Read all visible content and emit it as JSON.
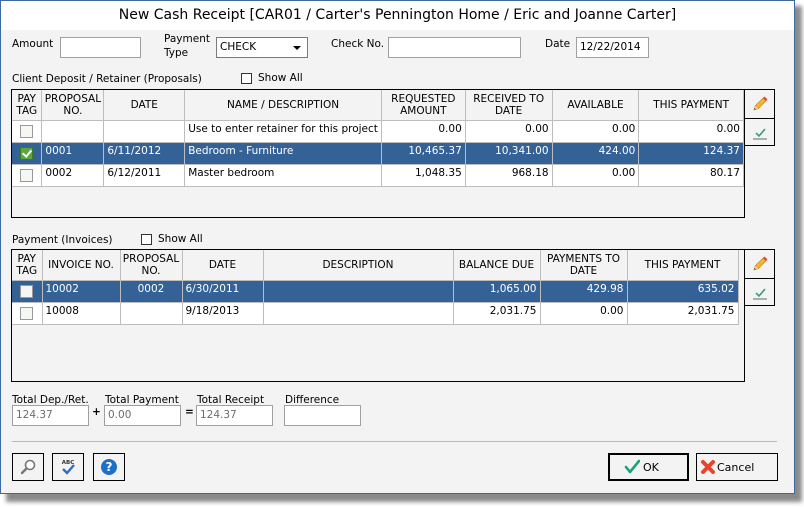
{
  "window": {
    "title": "New Cash Receipt [CAR01 / Carter's Pennington Home / Eric and Joanne Carter]"
  },
  "header": {
    "amount_label": "Amount",
    "amount_value": "",
    "payment_type_label_1": "Payment",
    "payment_type_label_2": "Type",
    "payment_type_value": "CHECK",
    "check_no_label": "Check No.",
    "check_no_value": "",
    "date_label": "Date",
    "date_value": "12/22/2014"
  },
  "deposits": {
    "section_label": "Client Deposit / Retainer (Proposals)",
    "show_all_label": "Show All",
    "show_all_checked": false,
    "columns": [
      {
        "line1": "PAY",
        "line2": "TAG"
      },
      {
        "line1": "PROPOSAL",
        "line2": "NO."
      },
      {
        "line1": "DATE",
        "line2": ""
      },
      {
        "line1": "NAME / DESCRIPTION",
        "line2": ""
      },
      {
        "line1": "REQUESTED",
        "line2": "AMOUNT"
      },
      {
        "line1": "RECEIVED TO",
        "line2": "DATE"
      },
      {
        "line1": "AVAILABLE",
        "line2": ""
      },
      {
        "line1": "THIS PAYMENT",
        "line2": ""
      }
    ],
    "rows": [
      {
        "tagged": false,
        "selected": false,
        "proposal_no": "",
        "date": "",
        "description": "Use to enter retainer for this project",
        "requested": "0.00",
        "received": "0.00",
        "available": "0.00",
        "this_payment": "0.00"
      },
      {
        "tagged": true,
        "selected": true,
        "proposal_no": "0001",
        "date": "6/11/2012",
        "description": "Bedroom - Furniture",
        "requested": "10,465.37",
        "received": "10,341.00",
        "available": "424.00",
        "this_payment": "124.37"
      },
      {
        "tagged": false,
        "selected": false,
        "proposal_no": "0002",
        "date": "6/12/2011",
        "description": "Master bedroom",
        "requested": "1,048.35",
        "received": "968.18",
        "available": "0.00",
        "this_payment": "80.17"
      }
    ],
    "side_buttons": [
      "pencil-icon",
      "checkmark-icon"
    ]
  },
  "invoices": {
    "section_label": "Payment (Invoices)",
    "show_all_label": "Show All",
    "show_all_checked": false,
    "columns": [
      {
        "line1": "PAY",
        "line2": "TAG"
      },
      {
        "line1": "INVOICE NO.",
        "line2": ""
      },
      {
        "line1": "PROPOSAL",
        "line2": "NO."
      },
      {
        "line1": "DATE",
        "line2": ""
      },
      {
        "line1": "DESCRIPTION",
        "line2": ""
      },
      {
        "line1": "BALANCE DUE",
        "line2": ""
      },
      {
        "line1": "PAYMENTS TO",
        "line2": "DATE"
      },
      {
        "line1": "THIS PAYMENT",
        "line2": ""
      }
    ],
    "rows": [
      {
        "tagged": false,
        "selected": true,
        "invoice_no": "10002",
        "proposal_no": "0002",
        "date": "6/30/2011",
        "description": "",
        "balance_due": "1,065.00",
        "payments_to_date": "429.98",
        "this_payment": "635.02"
      },
      {
        "tagged": false,
        "selected": false,
        "invoice_no": "10008",
        "proposal_no": "",
        "date": "9/18/2013",
        "description": "",
        "balance_due": "2,031.75",
        "payments_to_date": "0.00",
        "this_payment": "2,031.75"
      }
    ]
  },
  "totals": {
    "dep_ret_label": "Total Dep./Ret.",
    "dep_ret_value": "124.37",
    "plus_sign": "+",
    "payment_label": "Total Payment",
    "payment_value": "0.00",
    "equals_sign": "=",
    "receipt_label": "Total Receipt",
    "receipt_value": "124.37",
    "difference_label": "Difference",
    "difference_value": ""
  },
  "footer": {
    "ok_label": "OK",
    "cancel_label": "Cancel",
    "tools": [
      "search-icon",
      "spellcheck-icon",
      "help-icon"
    ]
  },
  "colors": {
    "selection": "#346196",
    "window_border": "#3c6aa0",
    "ok_check": "#1fa07a",
    "cancel_x": "#e5472c",
    "help": "#1e6fc8"
  }
}
